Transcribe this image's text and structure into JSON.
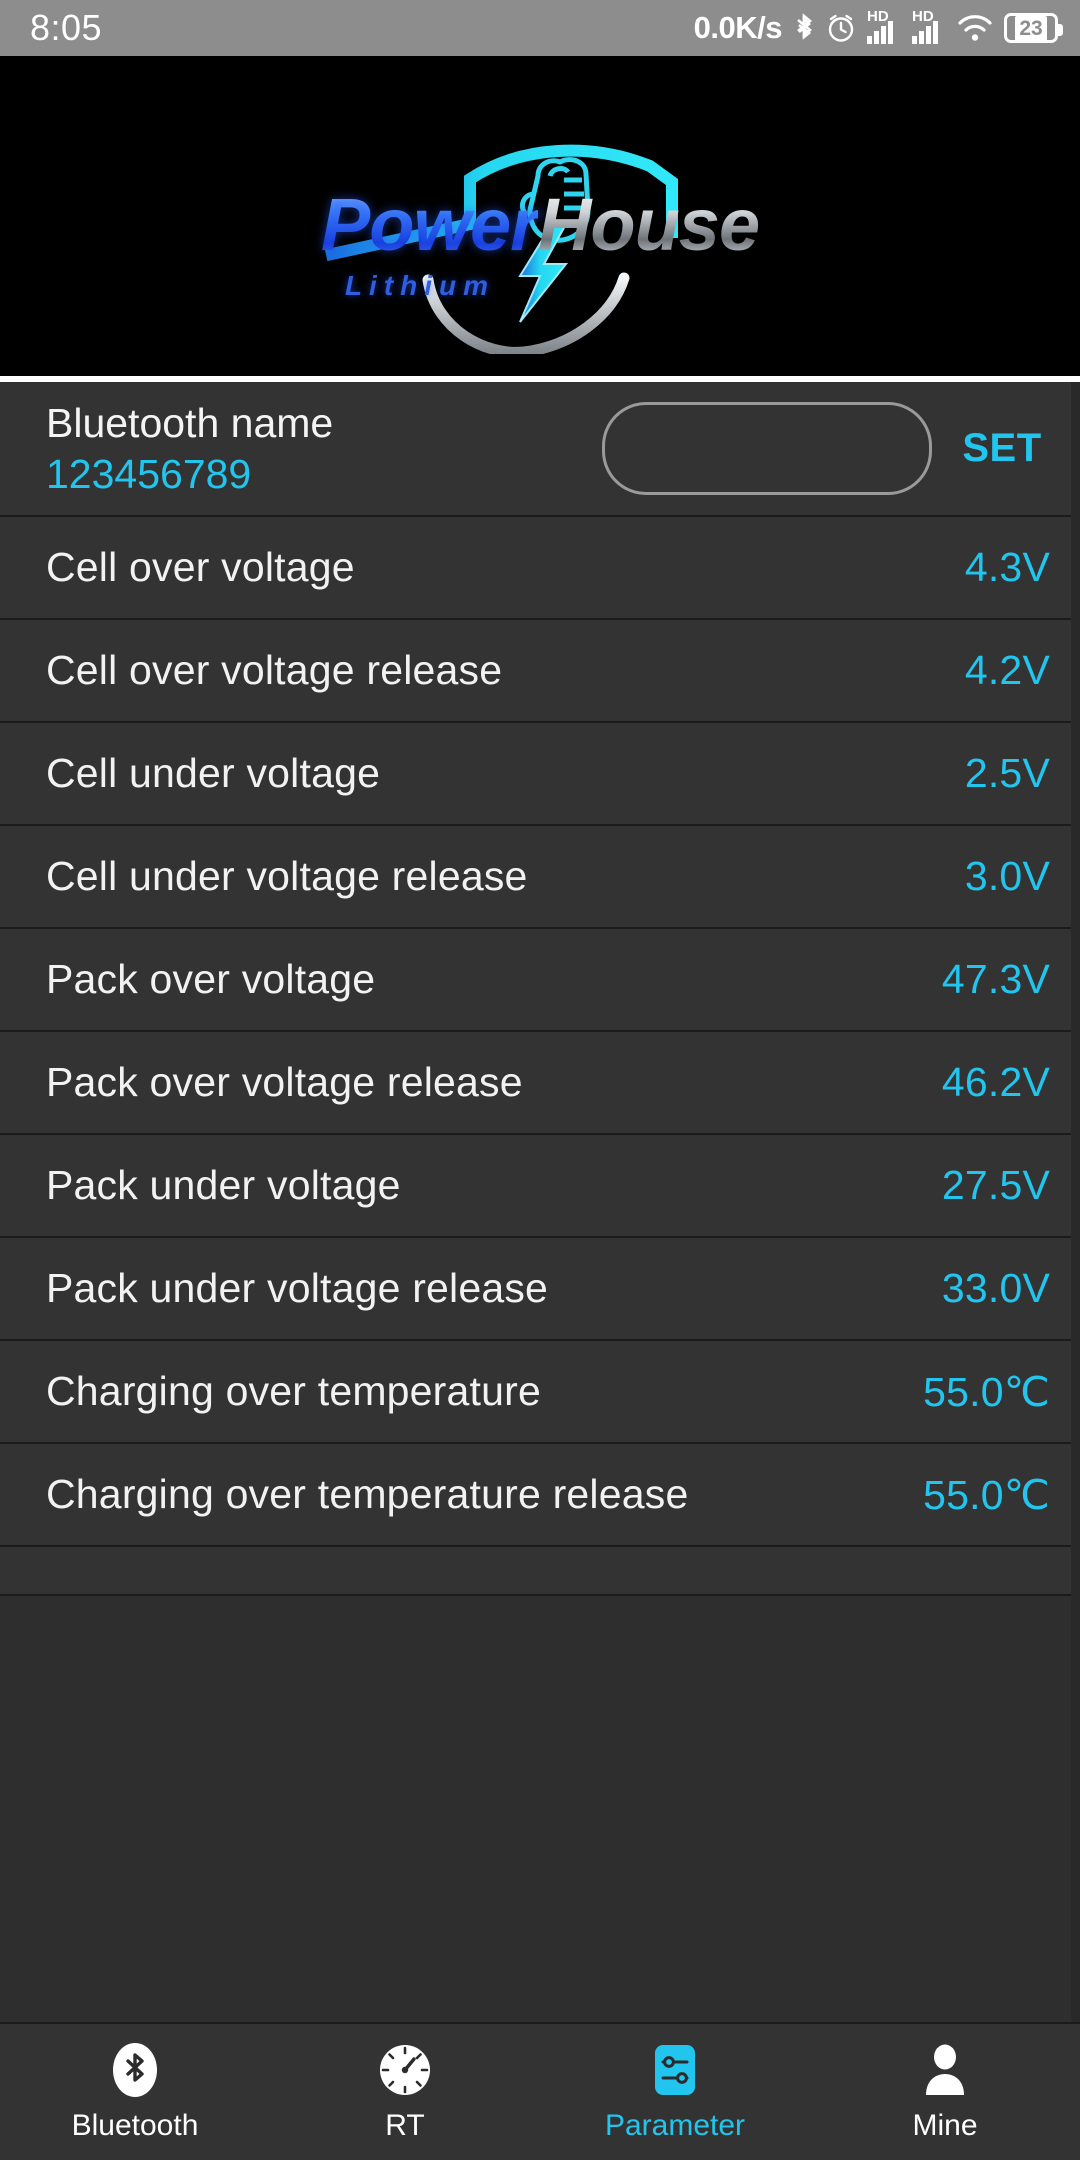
{
  "statusbar": {
    "time": "8:05",
    "net_speed": "0.0K/s",
    "bluetooth_icon": "bluetooth-icon",
    "alarm_icon": "alarm-icon",
    "signal1_label": "HD",
    "signal2_label": "HD",
    "wifi_icon": "wifi-icon",
    "battery_level": "23"
  },
  "banner": {
    "brand_power": "Power",
    "brand_house": "House",
    "brand_sub": "Lithium"
  },
  "bluetooth": {
    "title": "Bluetooth name",
    "value": "123456789",
    "input_value": "",
    "input_placeholder": "",
    "set_label": "SET"
  },
  "params": [
    {
      "label": "Cell over voltage",
      "value": "4.3V"
    },
    {
      "label": "Cell over voltage release",
      "value": "4.2V"
    },
    {
      "label": "Cell under voltage",
      "value": "2.5V"
    },
    {
      "label": "Cell under voltage release",
      "value": "3.0V"
    },
    {
      "label": "Pack over voltage",
      "value": "47.3V"
    },
    {
      "label": "Pack over voltage release",
      "value": "46.2V"
    },
    {
      "label": "Pack under voltage",
      "value": "27.5V"
    },
    {
      "label": "Pack under voltage release",
      "value": "33.0V"
    },
    {
      "label": "Charging over temperature",
      "value": "55.0℃"
    },
    {
      "label": "Charging over temperature release",
      "value": "55.0℃"
    }
  ],
  "bottomnav": {
    "items": [
      {
        "label": "Bluetooth",
        "icon": "bluetooth-icon",
        "active": false
      },
      {
        "label": "RT",
        "icon": "gauge-icon",
        "active": false
      },
      {
        "label": "Parameter",
        "icon": "sliders-icon",
        "active": true
      },
      {
        "label": "Mine",
        "icon": "person-icon",
        "active": false
      }
    ]
  },
  "colors": {
    "accent": "#22c5ee",
    "row_bg": "#333333",
    "page_bg": "#2e2e2e",
    "divider": "#1b1b1b",
    "statusbar_bg": "#8d8d8d",
    "banner_bg": "#000000"
  }
}
